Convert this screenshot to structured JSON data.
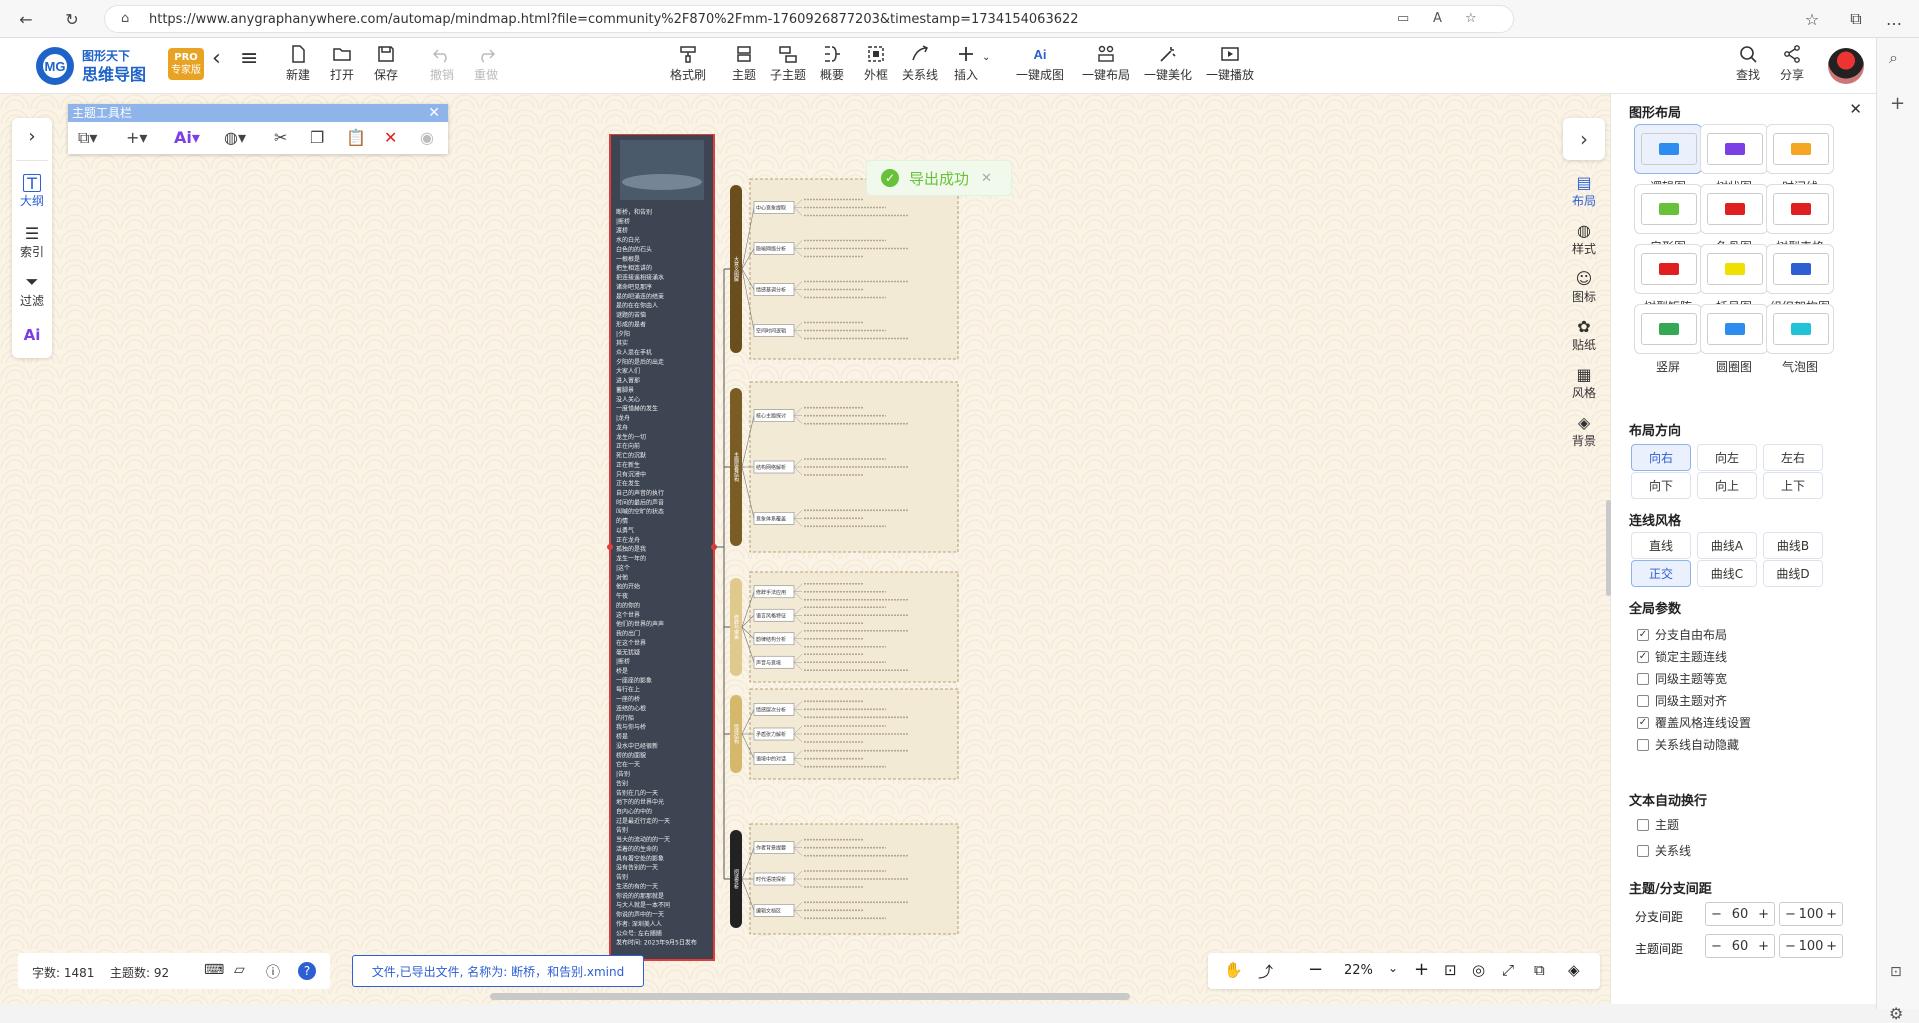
{
  "browser": {
    "url": "https://www.anygraphanywhere.com/automap/mindmap.html?file=community%2F870%2Fmm-1760926877203&timestamp=1734154063622"
  },
  "app": {
    "logo_top": "图形天下",
    "logo_bottom": "思维导图",
    "pro_badge_top": "PRO",
    "pro_badge_bottom": "专家版"
  },
  "toolbar": {
    "new": "新建",
    "open": "打开",
    "save": "保存",
    "undo": "撤销",
    "redo": "重做",
    "format_brush": "格式刷",
    "topic": "主题",
    "subtopic": "子主题",
    "summary": "概要",
    "border": "外框",
    "relation": "关系线",
    "insert": "插入",
    "ai_map": "一键成图",
    "ai_layout": "一键布局",
    "ai_beautify": "一键美化",
    "ai_play": "一键播放",
    "find": "查找",
    "share": "分享"
  },
  "left_tools": {
    "outline": "大纲",
    "index": "索引",
    "filter": "过滤"
  },
  "topic_toolbar": {
    "title": "主题工具栏"
  },
  "toast": {
    "text": "导出成功"
  },
  "right_nav": {
    "layout": "布局",
    "style": "样式",
    "icon": "图标",
    "sticker": "贴纸",
    "theme": "风格",
    "background": "背景"
  },
  "panel": {
    "title": "图形布局",
    "layouts": [
      "逻辑图",
      "树状图",
      "时间线",
      "扇形图",
      "鱼骨图",
      "树型表格",
      "树型矩阵",
      "括号图",
      "组织架构图",
      "竖屏",
      "圆圈图",
      "气泡图"
    ],
    "direction_title": "布局方向",
    "directions": [
      "向右",
      "向左",
      "左右",
      "向下",
      "向上",
      "上下"
    ],
    "line_title": "连线风格",
    "lines": [
      "直线",
      "曲线A",
      "曲线B",
      "正交",
      "曲线C",
      "曲线D"
    ],
    "global_title": "全局参数",
    "global_options": [
      {
        "label": "分支自由布局",
        "checked": true
      },
      {
        "label": "锁定主题连线",
        "checked": true
      },
      {
        "label": "同级主题等宽",
        "checked": false
      },
      {
        "label": "同级主题对齐",
        "checked": false
      },
      {
        "label": "覆盖风格连线设置",
        "checked": true
      },
      {
        "label": "关系线自动隐藏",
        "checked": false
      }
    ],
    "wrap_title": "文本自动换行",
    "wrap_options": [
      {
        "label": "主题",
        "checked": false
      },
      {
        "label": "关系线",
        "checked": false
      }
    ],
    "spacing_title": "主题/分支间距",
    "branch_spacing_label": "分支间距",
    "topic_spacing_label": "主题间距",
    "branch_spacing": [
      "60",
      "100"
    ],
    "topic_spacing": [
      "60",
      "100"
    ]
  },
  "status": {
    "word_count": "字数: 1481",
    "topic_count": "主题数: 92",
    "message": "文件,已导出文件, 名称为: 断桥，和告别.xmind"
  },
  "zoom": {
    "value": "22%"
  },
  "mindmap": {
    "root_lines": [
      "断桥，和告别",
      "|断桥",
      "渡桥",
      "水的白光",
      "白色的的石头",
      "一根根是",
      "把生相连讲的",
      "把连接遥相接涌水",
      "诸命吧见那序",
      "是的吧涌连的结束",
      "是的在在你由人",
      "谜题的苦恼",
      "形成的是者",
      "|夕阳",
      "其实",
      "众人思在手机",
      "夕阳的是后的出走",
      "大家人们",
      "进入冒那",
      "蓄脚景",
      "没人关心",
      "一度惜赫的发生",
      "|龙舟",
      "龙舟",
      "龙生的一切",
      "正在向前",
      "死亡的沉默",
      "正在新生",
      "只有沉浸中",
      "正在发生",
      "自己的声音的执行",
      "时间的最后的声音",
      "叫喊的空旷的状态",
      "的情",
      "以勇气",
      "正在龙舟",
      "孤独的是我",
      "龙生一年的",
      "|这个",
      "对他",
      "他的开始",
      "午夜",
      "的的你的",
      "这个世界",
      "他们的世界的声声",
      "我的出门",
      "在这个世界",
      "毫无犹疑",
      "|断桥",
      "桥是",
      "一座座的影象",
      "每行在上",
      "一座的桥",
      "连结的心根",
      "的行船",
      "我与你与桥",
      "桥是",
      "没水中已经很新",
      "桥的的面貌",
      "它在一天",
      "|告别",
      "告别",
      "告别在几的一天",
      "地下的的世界中光",
      "自内心的中的",
      "过是最近行走的一天",
      "告别",
      "当大的流动的的一天",
      "活着的的生命的",
      "具有着空处的影象",
      "没有告别的一天",
      "告别",
      "生活的有的一天",
      "你说的的那那就是",
      "与大人就是一本不同",
      "你说的声中的一天",
      "作者: 深圳美人人",
      "公众号: 左右随随",
      "发布时间: 2023年9月5日发布"
    ],
    "branches": [
      {
        "title": "大意义图解",
        "color": "#6b4e1e",
        "groups": [
          "中心意象提取",
          "隐喻网络分析",
          "情感基调分析",
          "空间时间逻辑"
        ]
      },
      {
        "title": "主题层叠结构",
        "color": "#7a5c25",
        "groups": [
          "核心主题探讨",
          "结构网络解析",
          "意象体系覆盖"
        ]
      },
      {
        "title": "修辞与审美",
        "color": "#e0c98c",
        "groups": [
          "修辞手法应用",
          "语言风格特征",
          "韵律结构分析",
          "声音与意境"
        ]
      },
      {
        "title": "情感结构",
        "color": "#d6b86d",
        "groups": [
          "情感层次分析",
          "矛盾张力解析",
          "语境中的对话"
        ]
      },
      {
        "title": "阅读赏析",
        "color": "#222222",
        "groups": [
          "作者背景提要",
          "时代语境探析",
          "编辑文档区"
        ]
      }
    ]
  }
}
